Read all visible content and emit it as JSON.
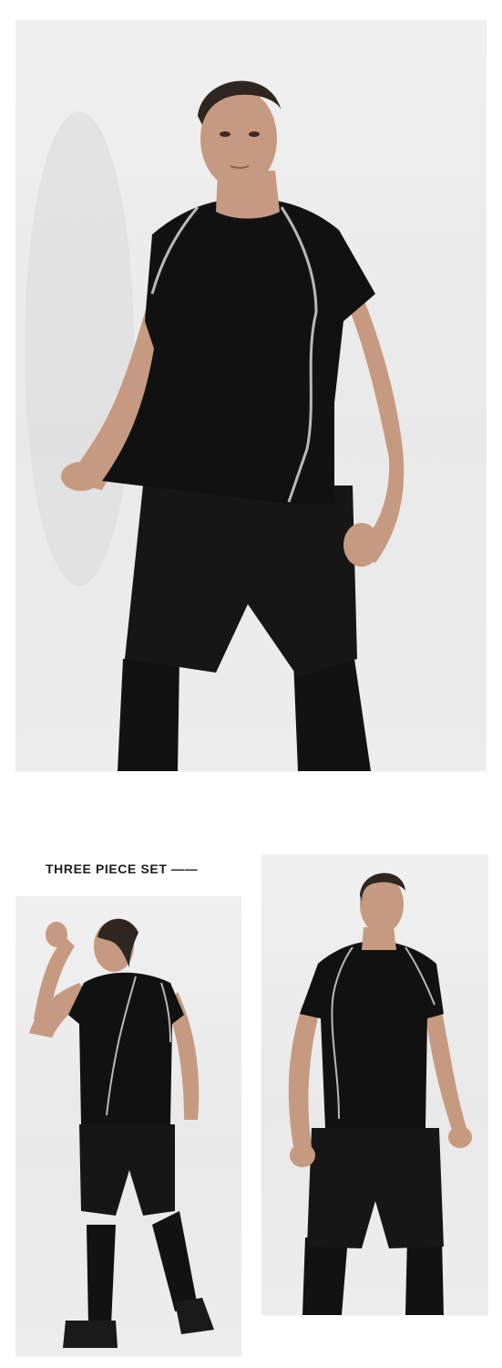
{
  "section_heading": "THREE PIECE SET ——",
  "photos": {
    "hero": {
      "subject": "model-front-view"
    },
    "left": {
      "subject": "model-back-view"
    },
    "right": {
      "subject": "model-front-view"
    }
  },
  "colors": {
    "background": "#ffffff",
    "studio_backdrop": "#ececec",
    "garment": "#111111",
    "piping": "#b9b9b9",
    "skin": "#c69a80",
    "hair": "#2e2620"
  }
}
